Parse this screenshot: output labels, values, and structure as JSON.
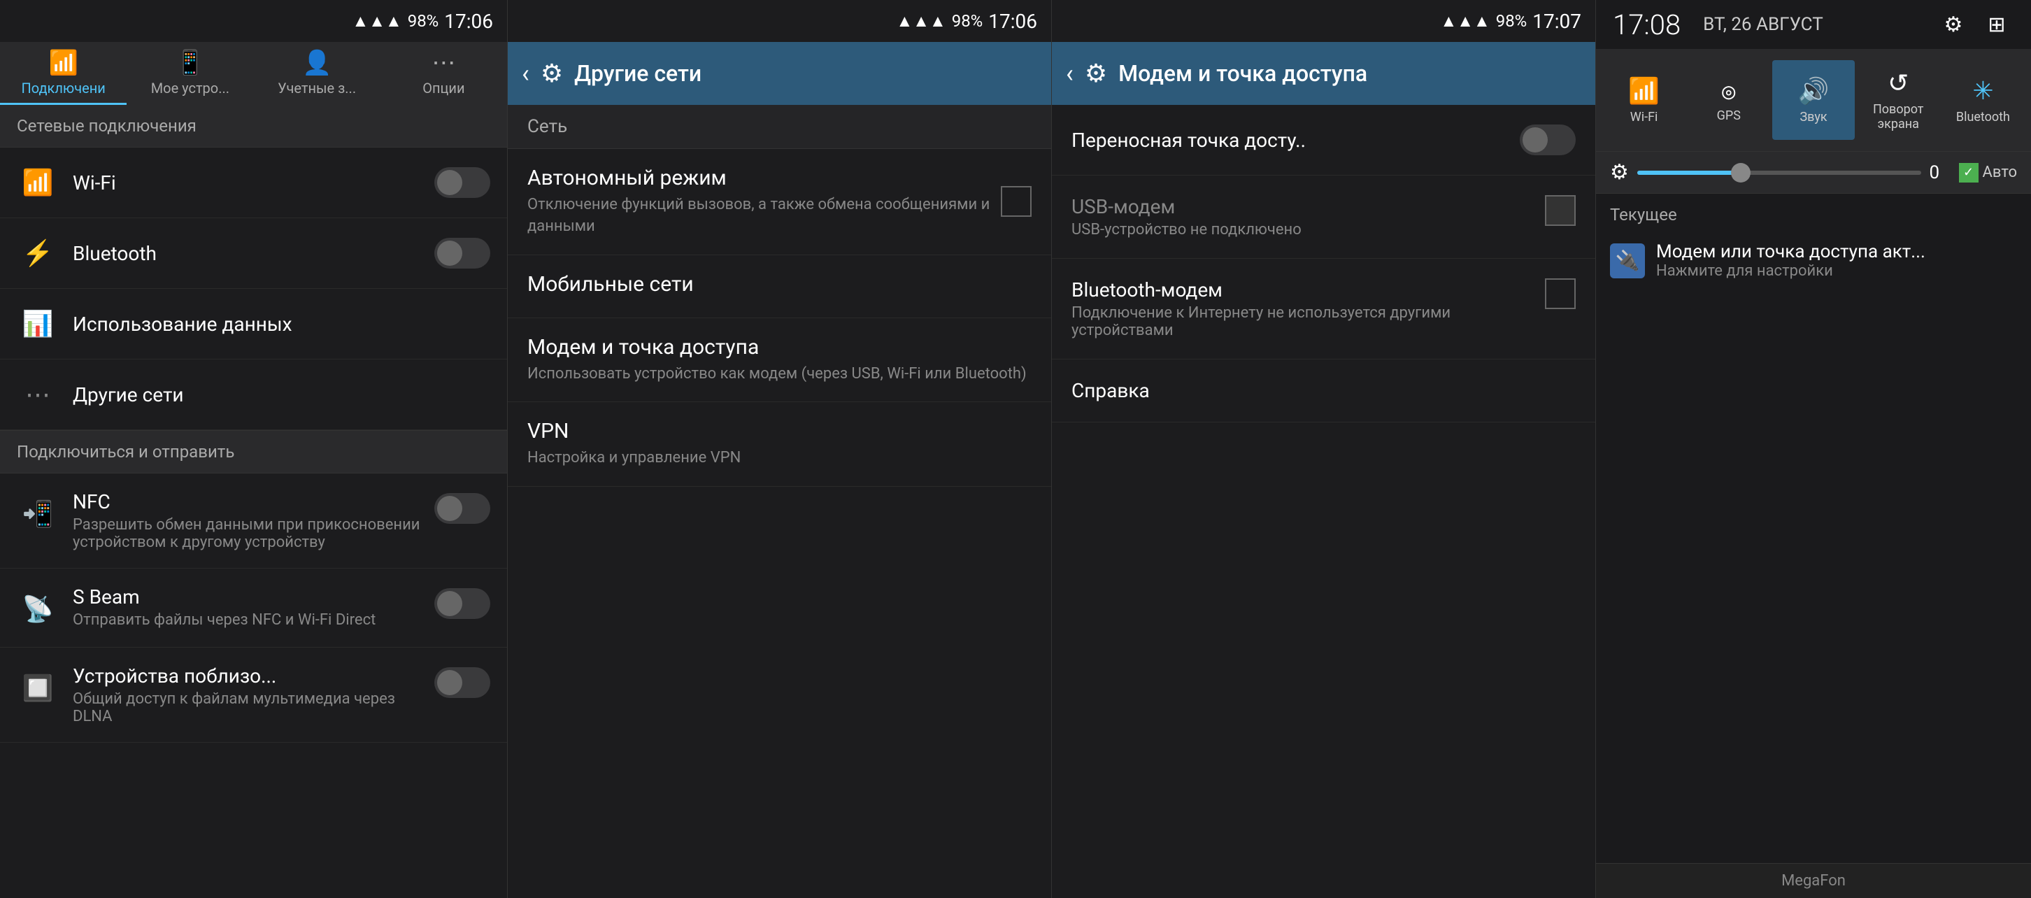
{
  "panel1": {
    "statusBar": {
      "signal": "98%",
      "battery": "98%",
      "time": "17:06"
    },
    "tabs": [
      {
        "label": "Подключени",
        "icon": "📶",
        "active": true
      },
      {
        "label": "Мое устро...",
        "icon": "📱",
        "active": false
      },
      {
        "label": "Учетные з...",
        "icon": "⚙️",
        "active": false
      },
      {
        "label": "Опции",
        "icon": "⋯",
        "active": false
      }
    ],
    "sectionHeader": "Сетевые подключения",
    "items": [
      {
        "id": "wifi",
        "icon": "📶",
        "title": "Wi-Fi",
        "toggle": true,
        "toggleOn": false
      },
      {
        "id": "bluetooth",
        "icon": "🔵",
        "title": "Bluetooth",
        "toggle": true,
        "toggleOn": false
      },
      {
        "id": "data-usage",
        "icon": "📊",
        "title": "Использование данных",
        "toggle": false
      },
      {
        "id": "other-networks",
        "icon": "⋯",
        "title": "Другие сети",
        "toggle": false
      }
    ],
    "divider": "Подключиться и отправить",
    "connectItems": [
      {
        "id": "nfc",
        "icon": "📲",
        "title": "NFC",
        "subtitle": "Разрешить обмен данными при прикосновении устройством к другому устройству",
        "toggle": true,
        "toggleOn": false
      },
      {
        "id": "sbeam",
        "icon": "📡",
        "title": "S Beam",
        "subtitle": "Отправить файлы через NFC и Wi-Fi Direct",
        "toggle": true,
        "toggleOn": false
      },
      {
        "id": "nearby",
        "icon": "🔲",
        "title": "Устройства поблизо...",
        "subtitle": "Общий доступ к файлам мультимедиа через DLNA",
        "toggle": true,
        "toggleOn": false
      }
    ]
  },
  "panel2": {
    "statusBar": {
      "signal": "98%",
      "battery": "98%",
      "time": "17:06"
    },
    "actionBar": {
      "title": "Другие сети",
      "backLabel": "‹",
      "gearLabel": "⚙"
    },
    "sectionHeader": "Сеть",
    "items": [
      {
        "id": "airplane",
        "title": "Автономный режим",
        "subtitle": "Отключение функций вызовов, а также обмена сообщениями и данными",
        "hasCheckbox": true
      },
      {
        "id": "mobile-networks",
        "title": "Мобильные сети",
        "subtitle": "",
        "hasCheckbox": false
      },
      {
        "id": "modem",
        "title": "Модем и точка доступа",
        "subtitle": "Использовать устройство как модем (через USB, Wi-Fi или Bluetooth)",
        "hasCheckbox": false
      },
      {
        "id": "vpn",
        "title": "VPN",
        "subtitle": "Настройка и управление VPN",
        "hasCheckbox": false
      }
    ]
  },
  "panel3": {
    "statusBar": {
      "signal": "98%",
      "battery": "98%",
      "time": "17:07"
    },
    "actionBar": {
      "title": "Модем и точка доступа",
      "backLabel": "‹",
      "gearLabel": "⚙"
    },
    "items": [
      {
        "id": "hotspot",
        "title": "Переносная точка досту..",
        "subtitle": "",
        "hasToggle": true,
        "toggleOn": false
      },
      {
        "id": "usb-modem",
        "title": "USB-модем",
        "subtitle": "USB-устройство не подключено",
        "hasCheckbox": true,
        "enabled": false
      },
      {
        "id": "bt-modem",
        "title": "Bluetooth-модем",
        "subtitle": "Подключение к Интернету не используется другими устройствами",
        "hasCheckbox": true,
        "enabled": true
      },
      {
        "id": "help",
        "title": "Справка",
        "subtitle": "",
        "hasCheckbox": false
      }
    ]
  },
  "panel4": {
    "statusBar": {
      "time": "17:08",
      "date": "ВТ, 26 АВГУСТ"
    },
    "quickSettings": [
      {
        "id": "wifi",
        "icon": "📶",
        "label": "Wi-Fi",
        "active": false
      },
      {
        "id": "gps",
        "icon": "◎",
        "label": "GPS",
        "active": false
      },
      {
        "id": "sound",
        "icon": "🔊",
        "label": "Звук",
        "active": true
      },
      {
        "id": "rotate",
        "icon": "↺",
        "label": "Поворот экрана",
        "active": false
      },
      {
        "id": "bluetooth",
        "icon": "🔵",
        "label": "Bluetooth",
        "active": false
      }
    ],
    "brightness": {
      "value": "0",
      "auto": "Авто"
    },
    "currentSection": "Текущее",
    "notification": {
      "icon": "🔌",
      "title": "Модем или точка доступа акт...",
      "subtitle": "Нажмите для настройки"
    },
    "carrier": "MegaFon"
  }
}
